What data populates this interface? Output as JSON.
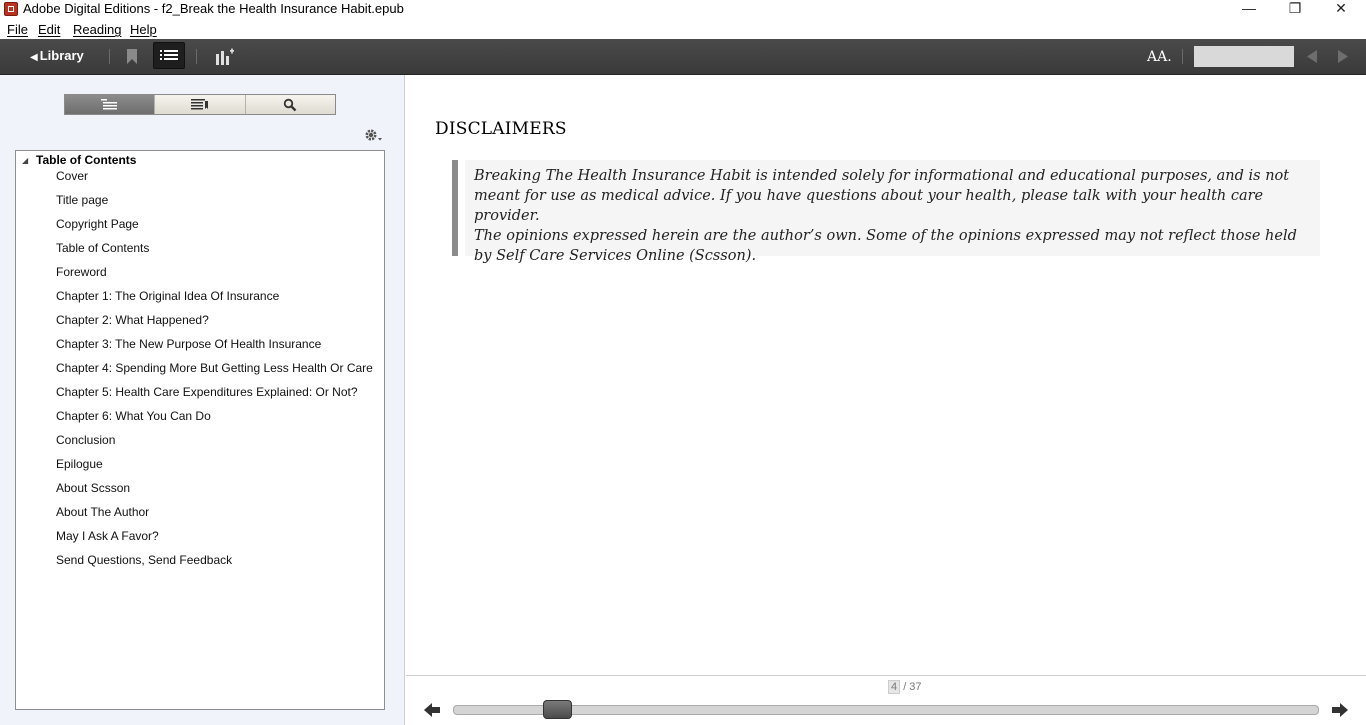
{
  "window": {
    "title": "Adobe Digital Editions - f2_Break the Health Insurance Habit.epub",
    "minimize": "—",
    "restore": "❐",
    "close": "✕"
  },
  "menu": {
    "items": [
      "File",
      "Edit",
      "Reading",
      "Help"
    ]
  },
  "toolbar": {
    "library_label": "Library",
    "library_arrow": "◀",
    "font_size_label": "AA.",
    "page_input_value": "",
    "icons": [
      "bookmark-icon",
      "toc-icon",
      "stats-icon",
      "font-size-icon",
      "prev-arrow-icon",
      "next-arrow-icon"
    ]
  },
  "sidebar": {
    "tabs": [
      {
        "name": "toc-tab",
        "icon": "contents-icon",
        "active": true
      },
      {
        "name": "bookmarks-tab",
        "icon": "bookmark-list-icon",
        "active": false
      },
      {
        "name": "search-tab",
        "icon": "search-icon",
        "active": false
      }
    ],
    "toc_header": "Table of Contents",
    "toc_items": [
      "Cover",
      "Title page",
      "Copyright Page",
      "Table of Contents",
      "Foreword",
      "Chapter 1: The Original Idea Of Insurance",
      "Chapter 2: What Happened?",
      "Chapter 3: The New Purpose Of Health Insurance",
      "Chapter 4: Spending More But Getting Less Health Or Care",
      "Chapter 5: Health Care Expenditures Explained: Or Not?",
      "Chapter 6: What You Can Do",
      "Conclusion",
      "Epilogue",
      "About Scsson",
      "About The Author",
      "May I Ask A Favor?",
      "Send Questions, Send Feedback"
    ]
  },
  "reader": {
    "heading": "DISCLAIMERS",
    "paragraph_1": "Breaking The Health Insurance Habit is intended solely for informational and educational purposes, and is not meant for use as medical advice. If you have questions about your health, please talk with your health care provider.",
    "paragraph_2": "The opinions expressed herein are the author’s own. Some of the opinions expressed may not reflect those held by Self Care Services Online (Scsson)."
  },
  "pager": {
    "current_page": "4",
    "total_pages": "/ 37",
    "progress_fraction": 0.108,
    "colors": {
      "accent": "#3a3a3a",
      "panel": "#f0f3fa"
    }
  }
}
